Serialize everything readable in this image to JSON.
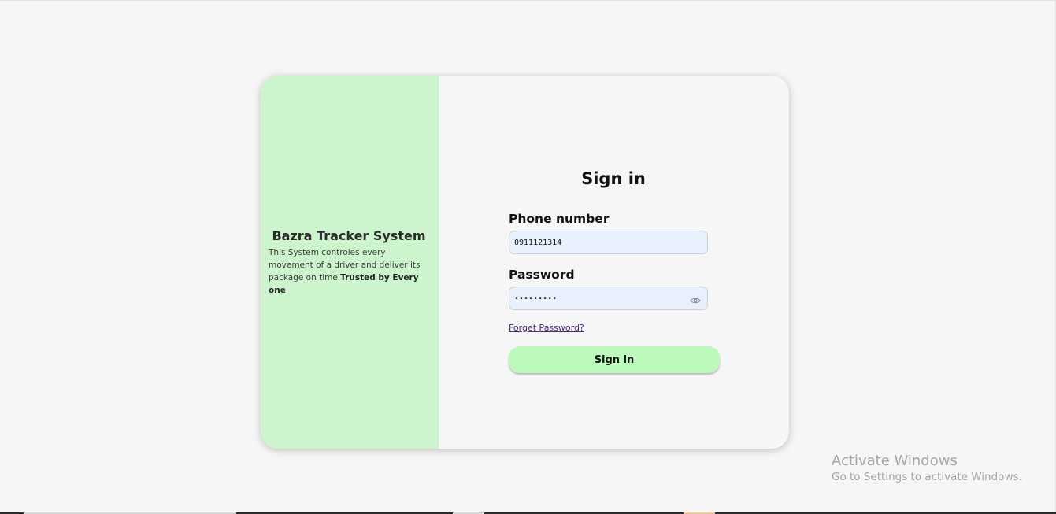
{
  "brand": {
    "title": "Bazra Tracker System",
    "description": "This System controles every movement of a driver and deliver its package on time.",
    "tagline": "Trusted by Every one"
  },
  "signin": {
    "title": "Sign in",
    "phone_label": "Phone number",
    "phone_value": "0911121314",
    "password_label": "Password",
    "password_value": "•••••••••",
    "forget_link": "Forget Password?",
    "submit_label": "Sign in"
  },
  "watermark": {
    "title": "Activate Windows",
    "subtitle": "Go to Settings to activate Windows."
  },
  "colors": {
    "left_panel": "#ccf5cd",
    "button": "#bcfabb",
    "input_bg": "#e8f0fe",
    "link": "#4b2a82"
  },
  "icons": {
    "password_toggle": "eye-icon"
  }
}
